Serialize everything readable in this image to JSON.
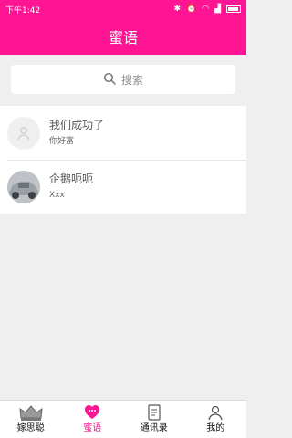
{
  "status": {
    "time": "下午1:42"
  },
  "header": {
    "title": "蜜语"
  },
  "search": {
    "placeholder": "搜索"
  },
  "chats": [
    {
      "name": "我们成功了",
      "message": "你好富",
      "avatar_icon": "default-avatar-icon"
    },
    {
      "name": "企鹅呃呃",
      "message": "Xxx",
      "avatar_icon": "car-avatar-icon"
    }
  ],
  "tabs": [
    {
      "label": "嫁思聪",
      "icon": "crown-icon",
      "active": false
    },
    {
      "label": "蜜语",
      "icon": "heart-chat-icon",
      "active": true
    },
    {
      "label": "通讯录",
      "icon": "contacts-icon",
      "active": false
    },
    {
      "label": "我的",
      "icon": "person-icon",
      "active": false
    }
  ],
  "colors": {
    "accent": "#ff1493",
    "background": "#efeff0"
  }
}
